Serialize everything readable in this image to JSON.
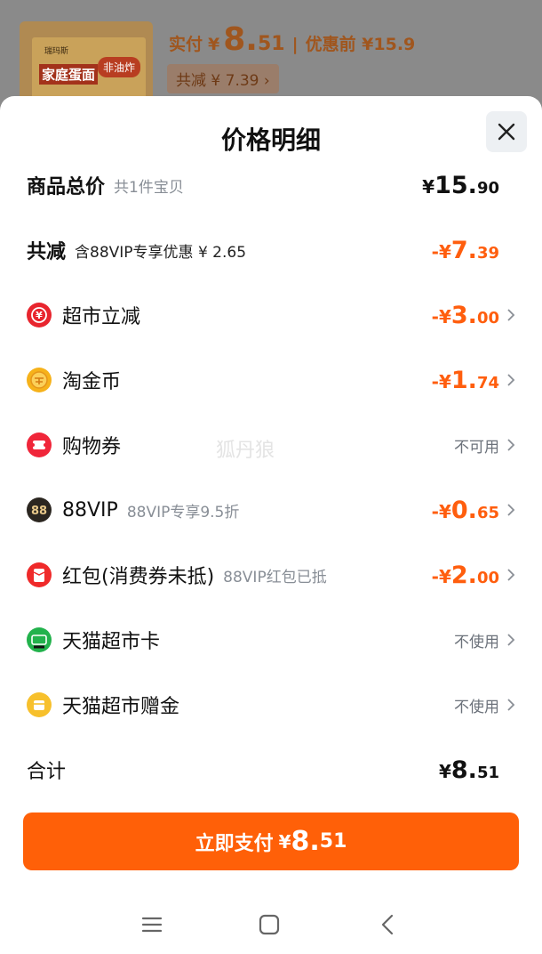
{
  "background": {
    "product_box": {
      "brand": "瑞玛斯",
      "name": "家庭蛋面",
      "tag": "非油炸"
    },
    "paid_label": "实付",
    "paid_yen": "¥",
    "paid_int": "8.",
    "paid_dec": "51",
    "separator": "|",
    "original_price": "优惠前 ¥15.9",
    "discount_badge": "共减 ¥ 7.39 ›"
  },
  "sheet": {
    "title": "价格明细",
    "close_icon": "close-icon",
    "watermark": "狐丹狼"
  },
  "rows": [
    {
      "id": "total",
      "name": "商品总价",
      "sub": "共1件宝贝",
      "amount_sign": "¥",
      "amount_int": "15.",
      "amount_dec": "90"
    },
    {
      "id": "reduce",
      "name": "共减",
      "sub": "含88VIP专享优惠 ¥ 2.65",
      "amount_sign": "-¥",
      "amount_int": "7.",
      "amount_dec": "39"
    },
    {
      "id": "market",
      "name": "超市立减",
      "icon": "yuan-coupon-icon",
      "amount_sign": "-¥",
      "amount_int": "3.",
      "amount_dec": "00"
    },
    {
      "id": "coins",
      "name": "淘金币",
      "icon": "gold-coin-icon",
      "amount_sign": "-¥",
      "amount_int": "1.",
      "amount_dec": "74"
    },
    {
      "id": "voucher",
      "name": "购物券",
      "icon": "ticket-icon",
      "status": "不可用"
    },
    {
      "id": "vip",
      "name": "88VIP",
      "sub": "88VIP专享9.5折",
      "icon": "vip88-icon",
      "amount_sign": "-¥",
      "amount_int": "0.",
      "amount_dec": "65"
    },
    {
      "id": "redpack",
      "name": "红包(消费券未抵)",
      "sub": "88VIP红包已抵",
      "icon": "red-envelope-icon",
      "amount_sign": "-¥",
      "amount_int": "2.",
      "amount_dec": "00"
    },
    {
      "id": "card",
      "name": "天猫超市卡",
      "icon": "market-card-icon",
      "status": "不使用"
    },
    {
      "id": "gift",
      "name": "天猫超市赠金",
      "icon": "gift-money-icon",
      "status": "不使用"
    },
    {
      "id": "sum",
      "name": "合计",
      "amount_sign": "¥",
      "amount_int": "8.",
      "amount_dec": "51"
    }
  ],
  "pay_button": {
    "label": "立即支付",
    "yen": "¥",
    "int": "8.",
    "dec": "51"
  },
  "navbar": {
    "menu_icon": "menu-icon",
    "home_icon": "home-square-icon",
    "back_icon": "back-icon"
  },
  "colors": {
    "accent": "#ff6008",
    "discount": "#ff5e0e",
    "text": "#111111",
    "muted": "#888e96"
  }
}
